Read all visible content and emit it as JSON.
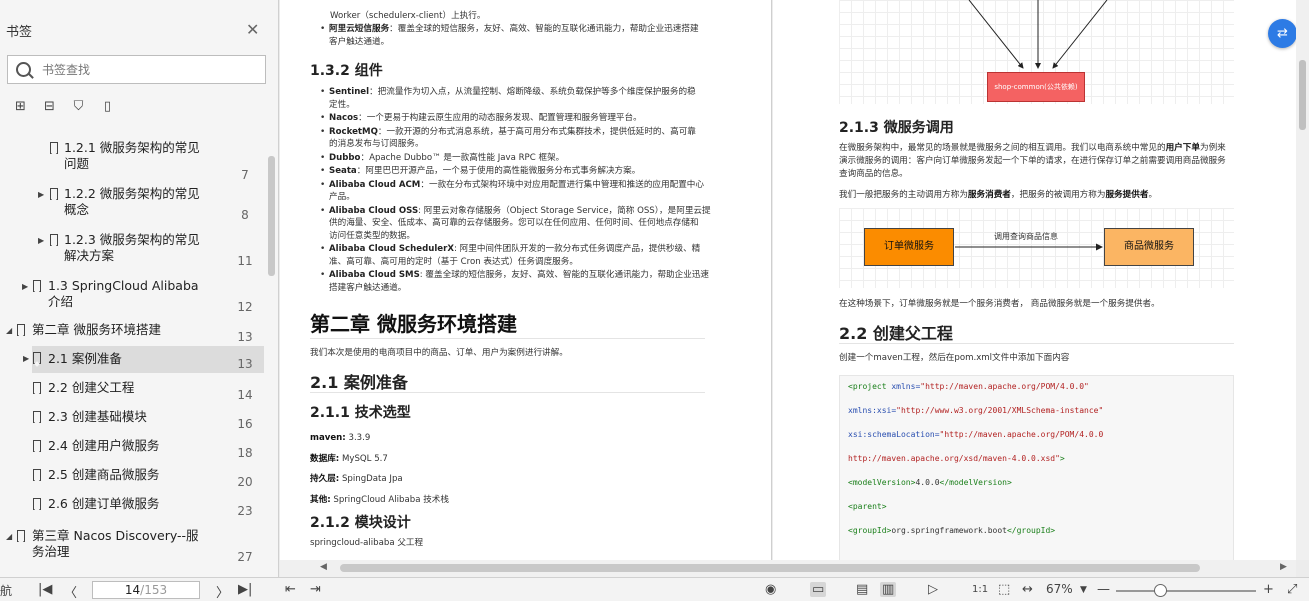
{
  "sidebar": {
    "title": "书签",
    "search_placeholder": "书签查找",
    "toc": [
      {
        "label1": "1.2.1 微服务架构的常见",
        "label2": "问题",
        "page": "7",
        "tri": false
      },
      {
        "label1": "1.2.2 微服务架构的常见",
        "label2": "概念",
        "page": "8",
        "tri": true
      },
      {
        "label1": "1.2.3 微服务架构的常见",
        "label2": "解决方案",
        "page": "11",
        "tri": true
      },
      {
        "label1": "1.3 SpringCloud Alibaba",
        "label2": "介绍",
        "page": "12",
        "tri": true
      },
      {
        "label1": "第二章 微服务环境搭建",
        "label2": "",
        "page": "13",
        "tri": true
      },
      {
        "label1": "2.1 案例准备",
        "label2": "",
        "page": "13",
        "tri": true
      },
      {
        "label1": "2.2 创建父工程",
        "label2": "",
        "page": "14",
        "tri": false
      },
      {
        "label1": "2.3 创建基础模块",
        "label2": "",
        "page": "16",
        "tri": false
      },
      {
        "label1": "2.4 创建用户微服务",
        "label2": "",
        "page": "18",
        "tri": false
      },
      {
        "label1": "2.5 创建商品微服务",
        "label2": "",
        "page": "20",
        "tri": false
      },
      {
        "label1": "2.6 创建订单微服务",
        "label2": "",
        "page": "23",
        "tri": false
      },
      {
        "label1": "第三章 Nacos Discovery--服",
        "label2": "务治理",
        "page": "27",
        "tri": true
      }
    ]
  },
  "left_page": {
    "top_line1": "Worker（schedulerx-client）上执行。",
    "top_b": "阿里云短信服务",
    "top_t": "：覆盖全球的短信服务，友好、高效、智能的互联化通讯能力，帮助企业迅速搭建",
    "top_t2": "客户触达通道。",
    "h_132": "1.3.2 组件",
    "components": [
      {
        "b": "Sentinel",
        "t": "：把流量作为切入点，从流量控制、熔断降级、系统负载保护等多个维度保护服务的稳",
        "t2": "定性。"
      },
      {
        "b": "Nacos",
        "t": "：一个更易于构建云原生应用的动态服务发现、配置管理和服务管理平台。",
        "t2": ""
      },
      {
        "b": "RocketMQ",
        "t": "：一款开源的分布式消息系统，基于高可用分布式集群技术，提供低延时的、高可靠",
        "t2": "的消息发布与订阅服务。"
      },
      {
        "b": "Dubbo",
        "t": "：Apache Dubbo™ 是一款高性能 Java RPC 框架。",
        "t2": ""
      },
      {
        "b": "Seata",
        "t": "：阿里巴巴开源产品，一个易于使用的高性能微服务分布式事务解决方案。",
        "t2": ""
      },
      {
        "b": "Alibaba Cloud ACM",
        "t": "：一款在分布式架构环境中对应用配置进行集中管理和推送的应用配置中心",
        "t2": "产品。"
      },
      {
        "b": "Alibaba Cloud OSS",
        "t": ": 阿里云对象存储服务（Object Storage Service，简称 OSS），是阿里云提",
        "t2": "供的海量、安全、低成本、高可靠的云存储服务。您可以在任何应用、任何时间、任何地点存储和",
        "t3": "访问任意类型的数据。"
      },
      {
        "b": "Alibaba Cloud SchedulerX",
        "t": ": 阿里中间件团队开发的一款分布式任务调度产品，提供秒级、精",
        "t2": "准、高可靠、高可用的定时（基于 Cron 表达式）任务调度服务。"
      },
      {
        "b": "Alibaba Cloud SMS",
        "t": ": 覆盖全球的短信服务，友好、高效、智能的互联化通讯能力，帮助企业迅速",
        "t2": "搭建客户触达通道。"
      }
    ],
    "h_ch2": "第二章 微服务环境搭建",
    "ch2_intro": "我们本次是使用的电商项目中的商品、订单、用户为案例进行讲解。",
    "h_21": "2.1 案例准备",
    "h_211": "2.1.1 技术选型",
    "tech": [
      {
        "k": "maven:",
        "v": "3.3.9"
      },
      {
        "k": "数据库:",
        "v": "MySQL 5.7"
      },
      {
        "k": "持久层:",
        "v": "SpingData Jpa"
      },
      {
        "k": "其他:",
        "v": "SpringCloud Alibaba 技术栈"
      }
    ],
    "h_212": "2.1.2 模块设计",
    "module_line": "springcloud-alibaba 父工程"
  },
  "right_page": {
    "shop_common": "shop-common(公共依赖)",
    "h_213": "2.1.3 微服务调用",
    "p1": "在微服务架构中，最常见的场景就是微服务之间的相互调用。我们以电商系统中常见的",
    "p1b": "用户下单",
    "p1c": "为例来",
    "p1_2": "演示微服务的调用：客户向订单微服务发起一个下单的请求，在进行保存订单之前需要调用商品微服务",
    "p1_3": "查询商品的信息。",
    "p2a": "我们一般把服务的主动调用方称为",
    "p2b": "服务消费者",
    "p2c": "，把服务的被调用方称为",
    "p2d": "服务提供者",
    "p2e": "。",
    "order_service": "订单微服务",
    "product_service": "商品微服务",
    "call_label": "调用查询商品信息",
    "p3": "在这种场景下，订单微服务就是一个服务消费者， 商品微服务就是一个服务提供者。",
    "h_22": "2.2 创建父工程",
    "p4": "创建一个maven工程，然后在pom.xml文件中添加下面内容",
    "code": {
      "l1_tag": "<project ",
      "l1_attr": "xmlns=",
      "l1_val": "\"http://maven.apache.org/POM/4.0.0\"",
      "l2_attr": "xmlns:xsi=",
      "l2_val": "\"http://www.w3.org/2001/XMLSchema-instance\"",
      "l3_attr": "xsi:schemaLocation=",
      "l3_val": "\"http://maven.apache.org/POM/4.0.0",
      "l4_val": "http://maven.apache.org/xsd/maven-4.0.0.xsd\"",
      "l4_end": ">",
      "l5_open": "<modelVersion>",
      "l5_text": "4.0.0",
      "l5_close": "</modelVersion>",
      "l6": "<parent>",
      "l7_open": "<groupId>",
      "l7_text": "org.springframework.boot",
      "l7_close": "</groupId>"
    }
  },
  "bottombar": {
    "left_cut": "航",
    "page_current": "14",
    "page_total": "/153",
    "zoom": "67%"
  },
  "colors": {
    "accent": "#2d7be5",
    "red_box": "#f46262",
    "orange_box": "#fb8c00",
    "light_box": "#fbb563"
  }
}
